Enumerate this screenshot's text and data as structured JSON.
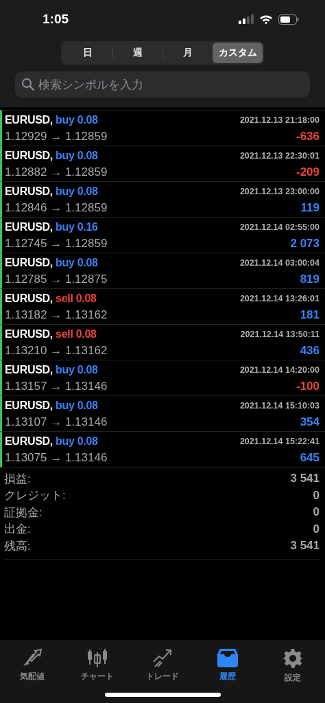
{
  "status_bar": {
    "time": "1:05"
  },
  "period_tabs": [
    {
      "label": "日",
      "selected": false
    },
    {
      "label": "週",
      "selected": false
    },
    {
      "label": "月",
      "selected": false
    },
    {
      "label": "カスタム",
      "selected": true
    }
  ],
  "search": {
    "placeholder": "検索シンボルを入力"
  },
  "trades": [
    {
      "symbol": "EURUSD,",
      "action": {
        "text": "buy 0.08",
        "color": "#3b82f6"
      },
      "time": "2021.12.13 21:18:00",
      "prices": "1.12929 → 1.12859",
      "profit": {
        "text": "-636",
        "color": "#e8453c"
      }
    },
    {
      "symbol": "EURUSD,",
      "action": {
        "text": "buy 0.08",
        "color": "#3b82f6"
      },
      "time": "2021.12.13 22:30:01",
      "prices": "1.12882 → 1.12859",
      "profit": {
        "text": "-209",
        "color": "#e8453c"
      }
    },
    {
      "symbol": "EURUSD,",
      "action": {
        "text": "buy 0.08",
        "color": "#3b82f6"
      },
      "time": "2021.12.13 23:00:00",
      "prices": "1.12846 → 1.12859",
      "profit": {
        "text": "119",
        "color": "#3b82f6"
      }
    },
    {
      "symbol": "EURUSD,",
      "action": {
        "text": "buy 0.16",
        "color": "#3b82f6"
      },
      "time": "2021.12.14 02:55:00",
      "prices": "1.12745 → 1.12859",
      "profit": {
        "text": "2 073",
        "color": "#3b82f6"
      }
    },
    {
      "symbol": "EURUSD,",
      "action": {
        "text": "buy 0.08",
        "color": "#3b82f6"
      },
      "time": "2021.12.14 03:00:04",
      "prices": "1.12785 → 1.12875",
      "profit": {
        "text": "819",
        "color": "#3b82f6"
      }
    },
    {
      "symbol": "EURUSD,",
      "action": {
        "text": "sell 0.08",
        "color": "#e8453c"
      },
      "time": "2021.12.14 13:26:01",
      "prices": "1.13182 → 1.13162",
      "profit": {
        "text": "181",
        "color": "#3b82f6"
      }
    },
    {
      "symbol": "EURUSD,",
      "action": {
        "text": "sell 0.08",
        "color": "#e8453c"
      },
      "time": "2021.12.14 13:50:11",
      "prices": "1.13210 → 1.13162",
      "profit": {
        "text": "436",
        "color": "#3b82f6"
      }
    },
    {
      "symbol": "EURUSD,",
      "action": {
        "text": "buy 0.08",
        "color": "#3b82f6"
      },
      "time": "2021.12.14 14:20:00",
      "prices": "1.13157 → 1.13146",
      "profit": {
        "text": "-100",
        "color": "#e8453c"
      }
    },
    {
      "symbol": "EURUSD,",
      "action": {
        "text": "buy 0.08",
        "color": "#3b82f6"
      },
      "time": "2021.12.14 15:10:03",
      "prices": "1.13107 → 1.13146",
      "profit": {
        "text": "354",
        "color": "#3b82f6"
      }
    },
    {
      "symbol": "EURUSD,",
      "action": {
        "text": "buy 0.08",
        "color": "#3b82f6"
      },
      "time": "2021.12.14 15:22:41",
      "prices": "1.13075 → 1.13146",
      "profit": {
        "text": "645",
        "color": "#3b82f6"
      }
    }
  ],
  "summary": [
    {
      "label": "損益:",
      "value": "3 541"
    },
    {
      "label": "クレジット:",
      "value": "0"
    },
    {
      "label": "証拠金:",
      "value": "0"
    },
    {
      "label": "出金:",
      "value": "0"
    },
    {
      "label": "残高:",
      "value": "3 541"
    }
  ],
  "tab_bar": [
    {
      "label": "気配値",
      "selected": false
    },
    {
      "label": "チャート",
      "selected": false
    },
    {
      "label": "トレード",
      "selected": false
    },
    {
      "label": "履歴",
      "selected": true
    },
    {
      "label": "設定",
      "selected": false
    }
  ]
}
